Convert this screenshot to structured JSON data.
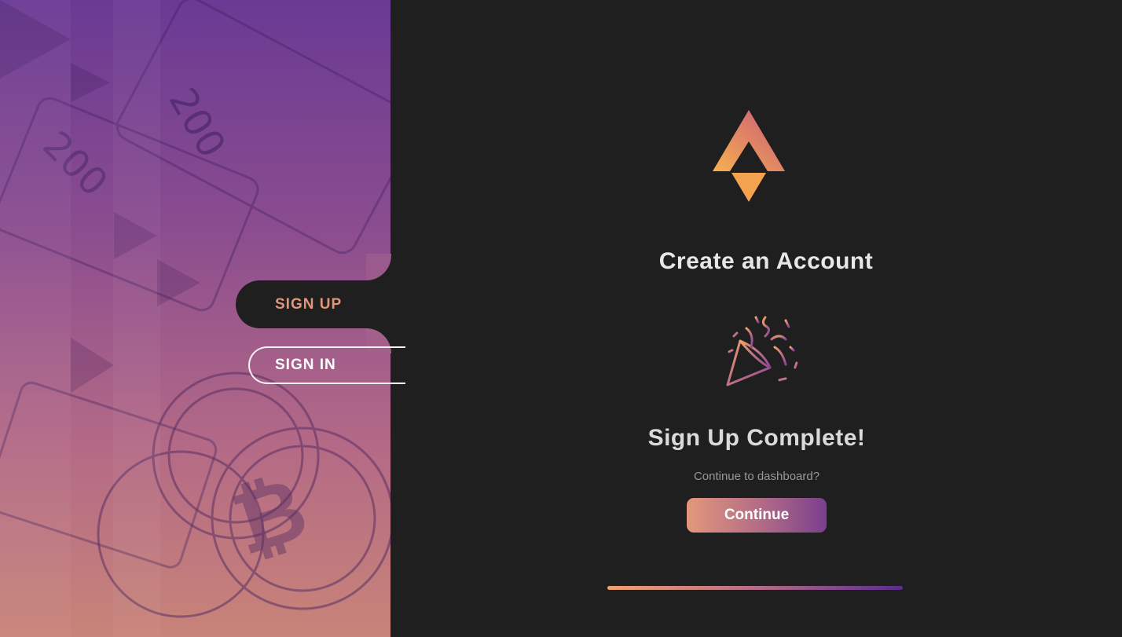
{
  "tabs": {
    "sign_up": "SIGN UP",
    "sign_in": "SIGN IN",
    "active": "sign_up"
  },
  "main": {
    "title": "Create an Account",
    "complete_heading": "Sign Up Complete!",
    "subtitle": "Continue to dashboard?",
    "continue_label": "Continue"
  },
  "progress": {
    "value": 1.0
  },
  "icons": {
    "logo": "brand-logo",
    "celebration": "party-popper-icon"
  },
  "colors": {
    "accent": "#e3957a",
    "gradient_start": "#f0a270",
    "gradient_end": "#5b2c8e",
    "background": "#1f1f1f"
  }
}
